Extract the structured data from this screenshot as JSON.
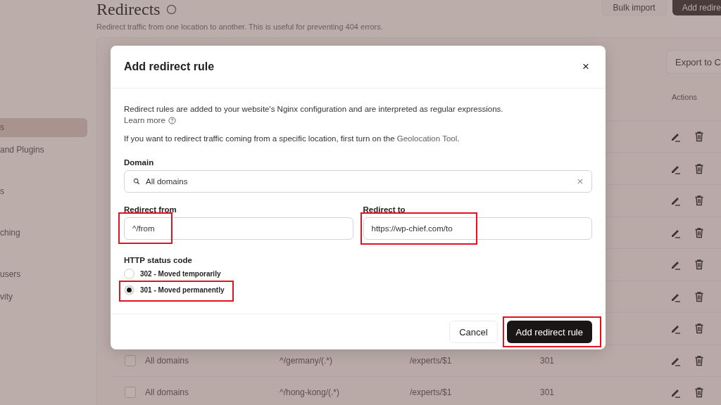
{
  "sidebar": {
    "items": [
      {
        "label": "s",
        "selected": true
      },
      {
        "label": "and Plugins",
        "selected": false
      },
      {
        "label": "s",
        "selected": false
      },
      {
        "label": "ching",
        "selected": false
      },
      {
        "label": "users",
        "selected": false
      },
      {
        "label": "vity",
        "selected": false
      }
    ]
  },
  "page": {
    "title": "Redirects",
    "subtitle": "Redirect traffic from one location to another. This is useful for preventing 404 errors.",
    "buttons": [
      "Bulk import",
      "Add redire"
    ]
  },
  "table": {
    "export_button": "Export to C",
    "columns": [
      "Actions"
    ],
    "rows": [
      {},
      {},
      {},
      {},
      {},
      {},
      {},
      {
        "checked": false,
        "domain": "All domains",
        "from": "^/germany/(.*)",
        "to": "/experts/$1",
        "code": "301"
      },
      {
        "checked": false,
        "domain": "All domains",
        "from": "^/hong-kong/(.*)",
        "to": "/experts/$1",
        "code": "301"
      }
    ]
  },
  "dialog": {
    "title": "Add redirect rule",
    "close": "×",
    "intro": "Redirect rules are added to your website's Nginx configuration and are interpreted as regular expressions.",
    "learn_more": "Learn more",
    "geo_text": "If you want to redirect traffic coming from a specific location, first turn on the",
    "geo_link": "Geolocation Tool",
    "geo_end": ".",
    "domain": {
      "label": "Domain",
      "value": "All domains"
    },
    "from": {
      "label": "Redirect from",
      "value": "^/from",
      "highlighted": true
    },
    "to": {
      "label": "Redirect to",
      "value": "https://wp-chief.com/to",
      "highlighted": true
    },
    "status": {
      "label": "HTTP status code",
      "options": [
        {
          "label": "302 - Moved temporarily",
          "selected": false,
          "highlighted": false
        },
        {
          "label": "301 - Moved permanently",
          "selected": true,
          "highlighted": true
        }
      ]
    },
    "cancel": "Cancel",
    "submit": {
      "label": "Add redirect rule",
      "highlighted": true
    }
  }
}
